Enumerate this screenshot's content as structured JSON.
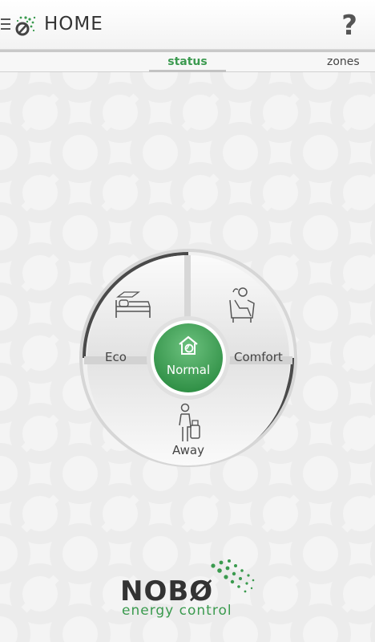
{
  "header": {
    "title": "HOME",
    "help_label": "?"
  },
  "tabs": {
    "status": "status",
    "zones": "zones"
  },
  "modes": {
    "eco": "Eco",
    "comfort": "Comfort",
    "away": "Away",
    "normal": "Normal"
  },
  "brand": {
    "name": "NOBØ",
    "tagline": "energy control"
  },
  "colors": {
    "accent_green": "#3a9a4e",
    "text_dark": "#333333"
  },
  "icons": {
    "menu": "menu-icon",
    "help": "question-mark",
    "eco": "bed-icon",
    "comfort": "armchair-person-icon",
    "away": "traveler-luggage-icon",
    "normal": "house-flame-icon"
  }
}
